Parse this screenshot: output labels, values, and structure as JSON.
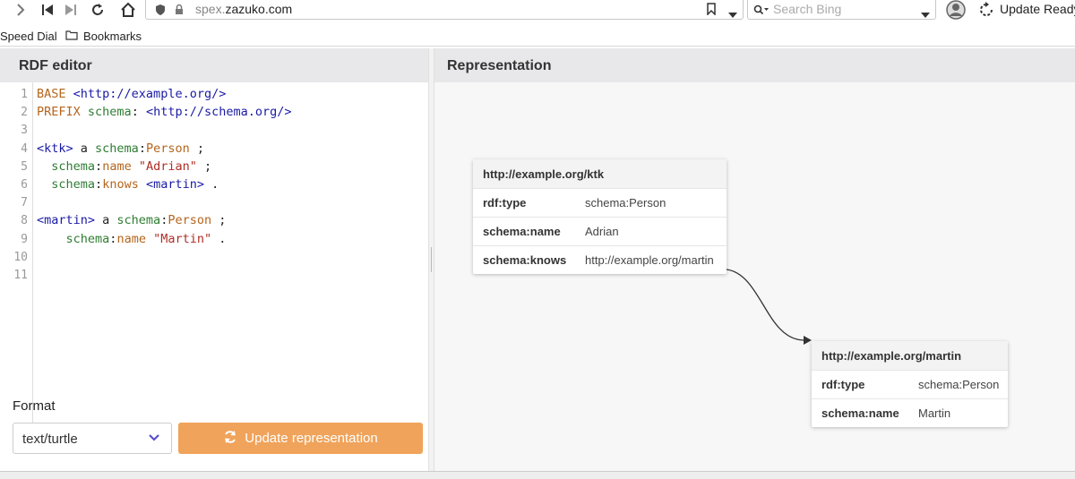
{
  "browser": {
    "url_prefix": "spex.",
    "url_domain": "zazuko.com",
    "search_placeholder": "Search Bing",
    "update_label": "Update Ready"
  },
  "bookmarks": {
    "speed_dial": "Speed Dial",
    "bookmarks": "Bookmarks"
  },
  "editor": {
    "title": "RDF editor",
    "line_numbers": [
      "1",
      "2",
      "3",
      "4",
      "5",
      "6",
      "7",
      "8",
      "9",
      "10",
      "11"
    ],
    "lines": [
      [
        [
          "k",
          "BASE"
        ],
        [
          "t",
          " "
        ],
        [
          "u",
          "<http://example.org/>"
        ]
      ],
      [
        [
          "k",
          "PREFIX"
        ],
        [
          "t",
          " "
        ],
        [
          "p",
          "schema"
        ],
        [
          "t",
          ": "
        ],
        [
          "u",
          "<http://schema.org/>"
        ]
      ],
      [],
      [
        [
          "u",
          "<ktk>"
        ],
        [
          "t",
          " a "
        ],
        [
          "p",
          "schema"
        ],
        [
          "t",
          ":"
        ],
        [
          "k",
          "Person"
        ],
        [
          "t",
          " ;"
        ]
      ],
      [
        [
          "t",
          "  "
        ],
        [
          "p",
          "schema"
        ],
        [
          "t",
          ":"
        ],
        [
          "k",
          "name"
        ],
        [
          "t",
          " "
        ],
        [
          "s",
          "\"Adrian\""
        ],
        [
          "t",
          " ;"
        ]
      ],
      [
        [
          "t",
          "  "
        ],
        [
          "p",
          "schema"
        ],
        [
          "t",
          ":"
        ],
        [
          "k",
          "knows"
        ],
        [
          "t",
          " "
        ],
        [
          "u",
          "<martin>"
        ],
        [
          "t",
          " ."
        ]
      ],
      [],
      [
        [
          "u",
          "<martin>"
        ],
        [
          "t",
          " a "
        ],
        [
          "p",
          "schema"
        ],
        [
          "t",
          ":"
        ],
        [
          "k",
          "Person"
        ],
        [
          "t",
          " ;"
        ]
      ],
      [
        [
          "t",
          "    "
        ],
        [
          "p",
          "schema"
        ],
        [
          "t",
          ":"
        ],
        [
          "k",
          "name"
        ],
        [
          "t",
          " "
        ],
        [
          "s",
          "\"Martin\""
        ],
        [
          "t",
          " ."
        ]
      ],
      [],
      []
    ],
    "format_label": "Format",
    "format_value": "text/turtle",
    "update_button": "Update representation"
  },
  "representation": {
    "title": "Representation",
    "nodes": [
      {
        "title": "http://example.org/ktk",
        "rows": [
          {
            "pred": "rdf:type",
            "obj": "schema:Person"
          },
          {
            "pred": "schema:name",
            "obj": "Adrian"
          },
          {
            "pred": "schema:knows",
            "obj": "http://example.org/martin"
          }
        ]
      },
      {
        "title": "http://example.org/martin",
        "rows": [
          {
            "pred": "rdf:type",
            "obj": "schema:Person"
          },
          {
            "pred": "schema:name",
            "obj": "Martin"
          }
        ]
      }
    ]
  },
  "colors": {
    "accent_button": "#f0a35a",
    "chevron": "#5a4fcf"
  }
}
